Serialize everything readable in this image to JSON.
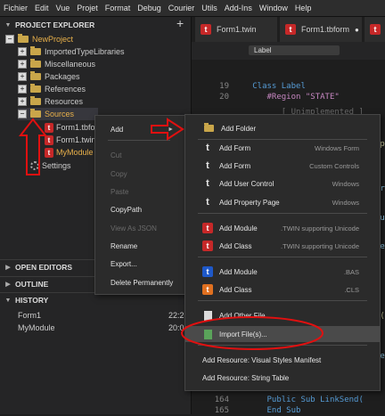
{
  "menubar": [
    "Fichier",
    "Edit",
    "Vue",
    "Projet",
    "Format",
    "Debug",
    "Courier",
    "Utils",
    "Add-Ins",
    "Window",
    "Help"
  ],
  "explorer": {
    "title": "PROJECT EXPLORER",
    "add_symbol": "+",
    "tree": [
      {
        "label": "NewProject",
        "kind": "folder",
        "expander": "−"
      },
      {
        "label": "ImportedTypeLibraries",
        "kind": "folder",
        "expander": "+"
      },
      {
        "label": "Miscellaneous",
        "kind": "folder",
        "expander": "+"
      },
      {
        "label": "Packages",
        "kind": "folder",
        "expander": "+"
      },
      {
        "label": "References",
        "kind": "folder",
        "expander": "+"
      },
      {
        "label": "Resources",
        "kind": "folder",
        "expander": "+"
      },
      {
        "label": "Sources",
        "kind": "folder",
        "expander": "−",
        "selected": true
      },
      {
        "label": "Form1.tbfo",
        "kind": "twin-form"
      },
      {
        "label": "Form1.twin",
        "kind": "twin-code"
      },
      {
        "label": "MyModule",
        "kind": "twin-module"
      },
      {
        "label": "Settings",
        "kind": "settings"
      }
    ],
    "sections": [
      {
        "title": "OPEN EDITORS",
        "expanded": false
      },
      {
        "title": "OUTLINE",
        "expanded": false
      },
      {
        "title": "HISTORY",
        "expanded": true
      }
    ],
    "history": [
      {
        "name": "Form1",
        "time": "22:2"
      },
      {
        "name": "MyModule",
        "time": "20:0"
      }
    ]
  },
  "editor": {
    "tabs": [
      {
        "label": "Form1.twin",
        "icon": "t"
      },
      {
        "label": "Form1.tbform",
        "icon": "t",
        "dot": "●"
      },
      {
        "label": "",
        "icon": "t"
      }
    ],
    "breadcrumb": "Label",
    "lines": [
      {
        "num": "19",
        "text": "   Class Label"
      },
      {
        "num": "20",
        "text": "      #Region \"STATE\""
      },
      {
        "num": "",
        "text": "         [ Unimplemented ]"
      },
      {
        "num": "164",
        "text": "      Public Sub LinkSend("
      },
      {
        "num": "165",
        "text": "      End Sub"
      }
    ],
    "edge_fragments": [
      "A",
      "1p",
      "ar",
      "ou",
      "Se",
      "e(",
      "ue"
    ]
  },
  "context_menu": {
    "items": [
      {
        "label": "Add",
        "submenu_arrow": "►",
        "enabled": true
      },
      {
        "label": "Cut",
        "enabled": false
      },
      {
        "label": "Copy",
        "enabled": false
      },
      {
        "label": "Paste",
        "enabled": false
      },
      {
        "label": "CopyPath",
        "enabled": true
      },
      {
        "label": "View As JSON",
        "enabled": false
      },
      {
        "label": "Rename",
        "enabled": true
      },
      {
        "label": "Export...",
        "enabled": true
      },
      {
        "label": "Delete Permanently",
        "enabled": true
      }
    ]
  },
  "add_submenu": {
    "items": [
      {
        "label": "Add Folder",
        "hint": "",
        "icon": "folder"
      },
      {
        "label": "Add Form",
        "hint": "Windows Form",
        "icon": "t-white"
      },
      {
        "label": "Add Form",
        "hint": "Custom Controls",
        "icon": "t-white"
      },
      {
        "label": "Add User Control",
        "hint": "Windows",
        "icon": "t-white"
      },
      {
        "label": "Add Property Page",
        "hint": "Windows",
        "icon": "t-white"
      },
      {
        "label": "Add Module",
        "hint": ".TWIN supporting Unicode",
        "icon": "t-red"
      },
      {
        "label": "Add Class",
        "hint": ".TWIN supporting Unicode",
        "icon": "t-red"
      },
      {
        "label": "Add Module",
        "hint": ".BAS",
        "icon": "t-blue"
      },
      {
        "label": "Add Class",
        "hint": ".CLS",
        "icon": "t-orange"
      },
      {
        "label": "Add Other File",
        "hint": "",
        "icon": "file"
      },
      {
        "label": "Import File(s)...",
        "hint": "",
        "icon": "import",
        "highlighted": true
      },
      {
        "label": "Add Resource: Visual Styles Manifest",
        "hint": "",
        "icon": ""
      },
      {
        "label": "Add Resource: String Table",
        "hint": "",
        "icon": ""
      }
    ]
  },
  "colors": {
    "annotation_red": "#e01010",
    "highlight_bg": "#4a4a4a",
    "folder": "#c9a64a"
  }
}
